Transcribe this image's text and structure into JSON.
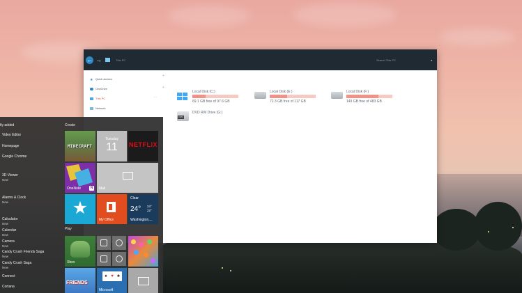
{
  "explorer": {
    "breadcrumb": "This PC",
    "search_placeholder": "Search This PC",
    "sidebar": [
      {
        "label": "Quick access",
        "icon": "star-icon"
      },
      {
        "label": "OneDrive",
        "icon": "cloud-icon"
      },
      {
        "label": "This PC",
        "icon": "computer-icon",
        "active": true
      },
      {
        "label": "Network",
        "icon": "network-icon"
      }
    ],
    "drives": [
      {
        "name": "Local Disk (C:)",
        "free": "69.1 GB free of 97.6 GB",
        "used_fraction": 0.29
      },
      {
        "name": "Local Disk (E:)",
        "free": "72.3 GB free of 117 GB",
        "used_fraction": 0.38
      },
      {
        "name": "Local Disk (F:)",
        "free": "149 GB free of 483 GB",
        "used_fraction": 0.69
      },
      {
        "name": "DVD RW Drive (G:)",
        "free": "",
        "tag": "DVD"
      }
    ]
  },
  "start_menu": {
    "recent_header": "tly added",
    "apps": [
      {
        "label": "Video Editor"
      },
      {
        "label": "Homepage"
      },
      {
        "label": "Google Chrome"
      },
      {
        "label": "3D Viewer",
        "badge": "New"
      },
      {
        "label": "Alarms & Clock",
        "badge": "New"
      },
      {
        "label": "Calculator",
        "badge": "New"
      },
      {
        "label": "Calendar",
        "badge": "New"
      },
      {
        "label": "Camera",
        "badge": "New"
      },
      {
        "label": "Candy Crush Friends Saga",
        "badge": "New"
      },
      {
        "label": "Candy Crush Saga",
        "badge": "New"
      },
      {
        "label": "Connect"
      },
      {
        "label": "Cortana"
      }
    ],
    "sections": {
      "create": "Create",
      "play": "Play"
    },
    "tiles": {
      "minecraft": "MINECRAFT",
      "calendar_day": "Tuesday",
      "calendar_date": "11",
      "netflix": "NETFLIX",
      "onenote": "OneNote",
      "mail": "Mail",
      "office": "My Office",
      "weather_condition": "Clear",
      "weather_temp": "24°",
      "weather_high": "24°",
      "weather_low": "22°",
      "weather_city": "Washington,...",
      "xbox": "Xbox",
      "friends": "FRIENDS",
      "solitaire": "Microsoft"
    }
  },
  "colors": {
    "accent": "#2f88c8",
    "active_nav": "#e0564b",
    "drive_fill": "#ef9287",
    "drive_track": "#f6c9c3"
  }
}
